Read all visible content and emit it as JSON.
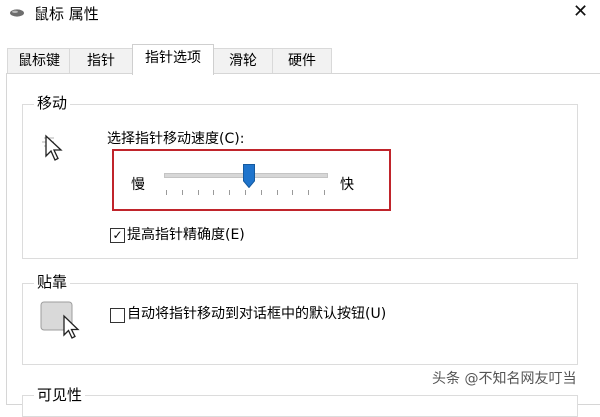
{
  "window": {
    "title": "鼠标 属性",
    "close_symbol": "✕",
    "app_icon": "mouse-icon"
  },
  "tabs": [
    {
      "label": "鼠标键"
    },
    {
      "label": "指针"
    },
    {
      "label": "指针选项",
      "active": true
    },
    {
      "label": "滑轮"
    },
    {
      "label": "硬件"
    }
  ],
  "motion": {
    "group_title": "移动",
    "speed_label": "选择指针移动速度(C):",
    "slow_label": "慢",
    "fast_label": "快",
    "speed_level": 0.5,
    "tick_count": 11,
    "precision_label": "提高指针精确度(E)",
    "precision_checked": true,
    "check_mark": "✓",
    "icon": "pointer-motion-icon"
  },
  "snap": {
    "group_title": "贴靠",
    "auto_snap_label": "自动将指针移动到对话框中的默认按钮(U)",
    "auto_snap_checked": false,
    "icon": "snap-to-button-icon"
  },
  "visibility": {
    "group_title": "可见性"
  },
  "watermark": "头条 @不知名网友叮当",
  "colors": {
    "highlight_border": "#c0242b",
    "slider_thumb": "#1f74cc"
  }
}
